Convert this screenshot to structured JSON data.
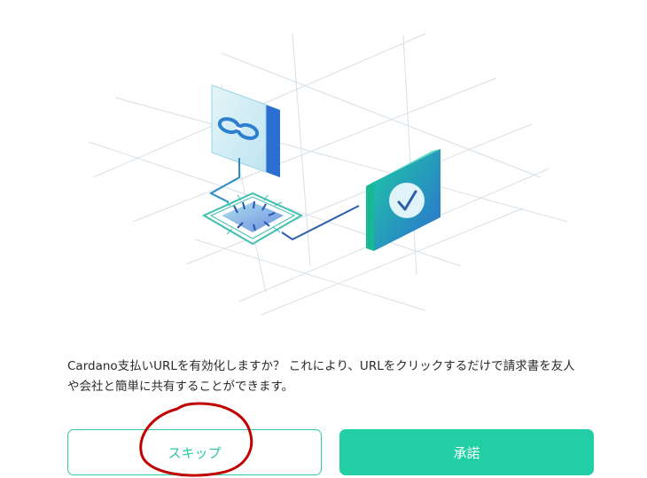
{
  "message": {
    "line1": "Cardano支払いURLを有効化しますか？ これにより、URLをクリックするだけで請求書を友人",
    "line2": "や会社と簡単に共有することができます。"
  },
  "buttons": {
    "skip_label": "スキップ",
    "accept_label": "承諾"
  },
  "icons": {
    "link": "link-icon",
    "check": "checkmark-icon",
    "chip": "chip-icon"
  },
  "colors": {
    "accent": "#22cfa4",
    "outline": "#2ec9a8",
    "annotation": "#c00000"
  }
}
